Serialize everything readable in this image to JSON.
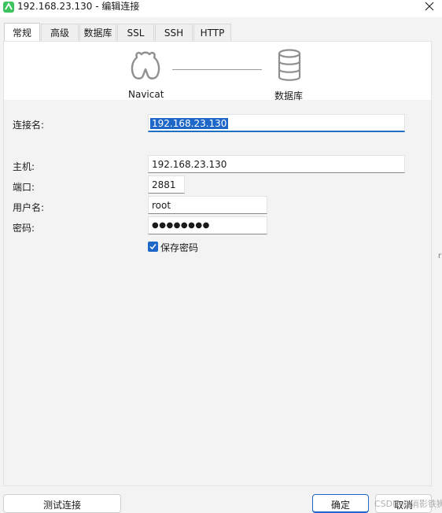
{
  "window": {
    "title": "192.168.23.130 - 编辑连接",
    "close_icon": "close-icon"
  },
  "tabs": [
    {
      "label": "常规",
      "active": true
    },
    {
      "label": "高级",
      "active": false
    },
    {
      "label": "数据库",
      "active": false
    },
    {
      "label": "SSL",
      "active": false
    },
    {
      "label": "SSH",
      "active": false
    },
    {
      "label": "HTTP",
      "active": false
    }
  ],
  "header": {
    "left_label": "Navicat",
    "right_label": "数据库"
  },
  "form": {
    "connection_name": {
      "label": "连接名:",
      "value": "192.168.23.130"
    },
    "host": {
      "label": "主机:",
      "value": "192.168.23.130"
    },
    "port": {
      "label": "端口:",
      "value": "2881"
    },
    "username": {
      "label": "用户名:",
      "value": "root"
    },
    "password": {
      "label": "密码:",
      "value": "●●●●●●●●"
    },
    "save_password": {
      "label": "保存密码",
      "checked": true
    }
  },
  "buttons": {
    "test": "测试连接",
    "ok": "确定",
    "cancel": "取消"
  },
  "watermark": "CSDN @消影铁狮",
  "edge_mark": "r",
  "colors": {
    "accent": "#1e67c8",
    "app_icon": "#3cc35f"
  }
}
